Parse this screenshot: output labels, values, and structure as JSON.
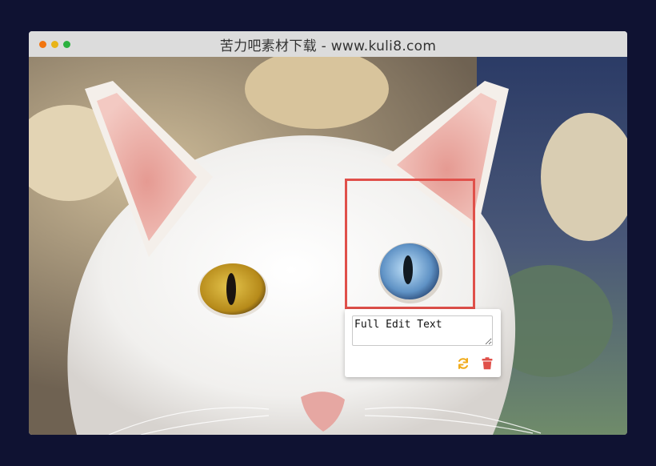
{
  "window": {
    "title": "苦力吧素材下载 - www.kuli8.com",
    "traffic_lights": [
      "#f2750f",
      "#e8b418",
      "#2bb13f"
    ]
  },
  "annotation": {
    "box_color": "#e0504a",
    "text_value": "Full Edit Text"
  },
  "popup": {
    "refresh_icon": "refresh-icon",
    "refresh_color": "#f0ab1a",
    "delete_icon": "trash-icon",
    "delete_color": "#e0504a"
  }
}
